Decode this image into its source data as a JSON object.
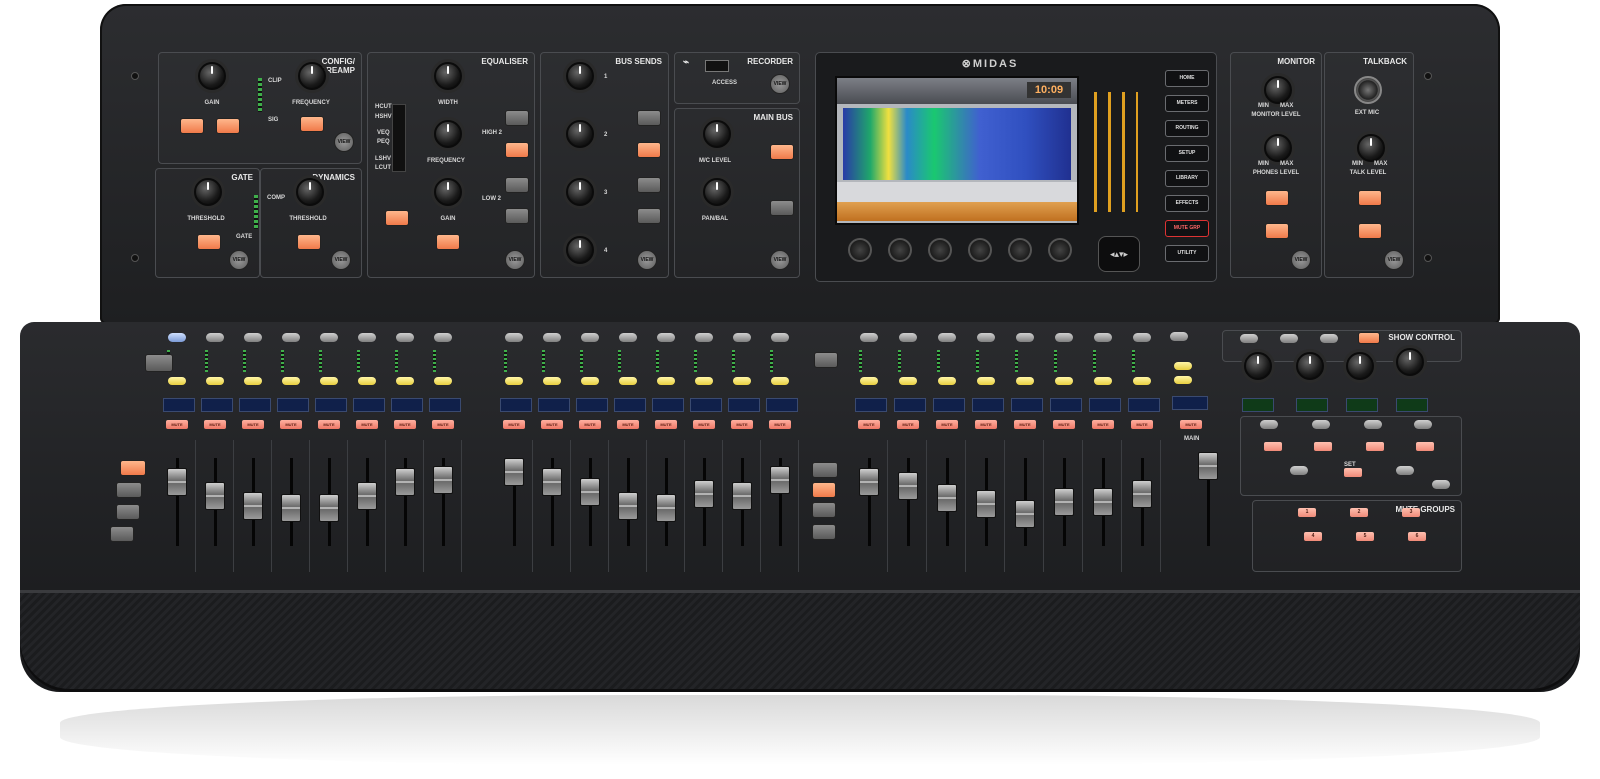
{
  "brand": {
    "logo": "⊗MIDAS"
  },
  "sections": {
    "config_preamp": {
      "title": "CONFIG/\nPREAMP",
      "gain": "GAIN",
      "frequency": "FREQUENCY",
      "clip": "CLIP",
      "sig": "SIG",
      "view": "VIEW"
    },
    "gate": {
      "title": "GATE",
      "threshold": "THRESHOLD",
      "view": "VIEW",
      "gate_led": "GATE"
    },
    "dynamics": {
      "title": "DYNAMICS",
      "threshold": "THRESHOLD",
      "comp": "COMP",
      "view": "VIEW"
    },
    "equaliser": {
      "title": "EQUALISER",
      "width": "WIDTH",
      "frequency": "FREQUENCY",
      "gain": "GAIN",
      "high2": "HIGH 2",
      "low2": "LOW 2",
      "view": "VIEW",
      "types": [
        "HCUT",
        "HSHV",
        "VEQ",
        "PEQ",
        "LSHV",
        "LCUT"
      ]
    },
    "bus_sends": {
      "title": "BUS SENDS",
      "numbers": [
        "1",
        "2",
        "3",
        "4"
      ],
      "view": "VIEW"
    },
    "recorder": {
      "title": "RECORDER",
      "access": "ACCESS",
      "view": "VIEW"
    },
    "main_bus": {
      "title": "MAIN BUS",
      "mc_level": "M/C LEVEL",
      "pan_bal": "PAN/BAL",
      "view": "VIEW"
    },
    "monitor": {
      "title": "MONITOR",
      "monitor_level": "MONITOR LEVEL",
      "phones_level": "PHONES LEVEL",
      "min": "MIN",
      "max": "MAX",
      "view": "VIEW"
    },
    "talkback": {
      "title": "TALKBACK",
      "ext_mic": "EXT MIC",
      "talk_level": "TALK LEVEL",
      "min": "MIN",
      "max": "MAX",
      "view": "VIEW"
    }
  },
  "screen": {
    "time": "10:09",
    "right_buttons": [
      "HOME",
      "METERS",
      "ROUTING",
      "SETUP",
      "LIBRARY",
      "EFFECTS",
      "MUTE GRP",
      "UTILITY"
    ]
  },
  "strips": {
    "mute_label": "MUTE",
    "main_label": "MAIN",
    "set_label": "SET",
    "show_control": "SHOW\nCONTROL",
    "mute_groups": "MUTE GROUPS",
    "mute_group_numbers": [
      "1",
      "2",
      "3",
      "4",
      "5",
      "6"
    ]
  },
  "colors": {
    "body": "#222326",
    "accent_orange": "#f07a4a",
    "mute_red": "#ee7766",
    "led_green": "#3fae4a"
  }
}
